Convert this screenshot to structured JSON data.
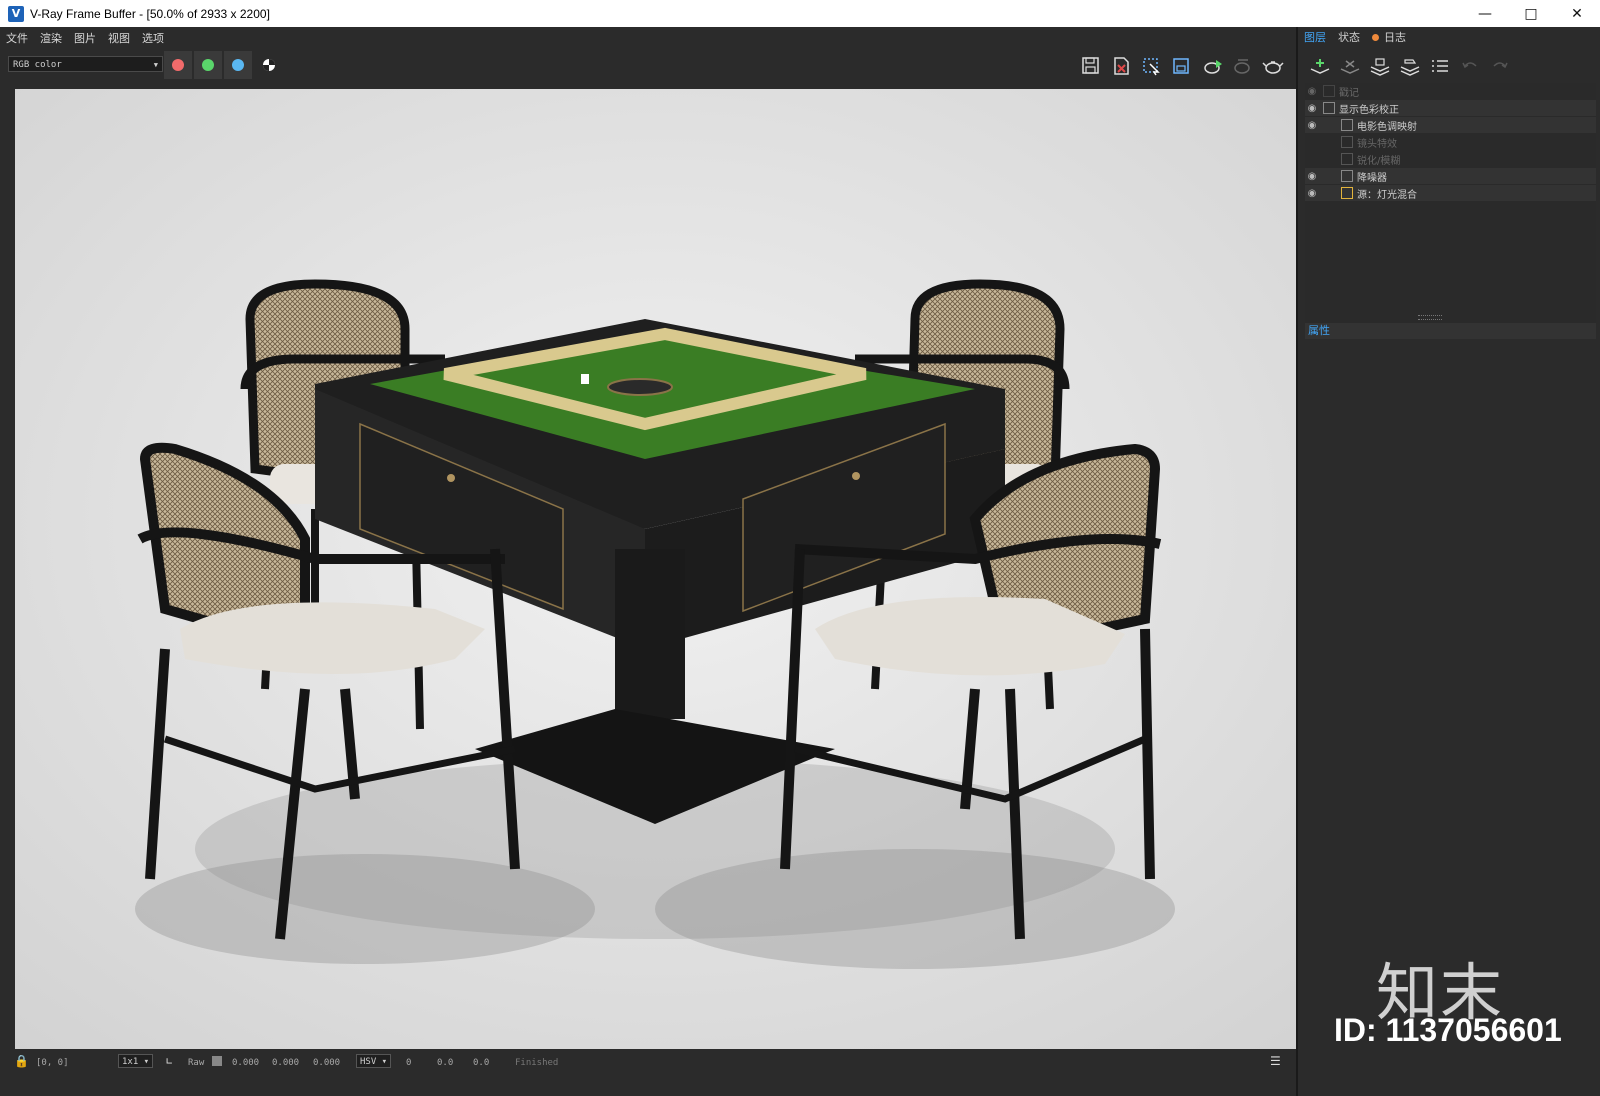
{
  "window": {
    "title": "V-Ray Frame Buffer - [50.0% of 2933 x 2200]",
    "app_icon": "vray-icon",
    "controls": [
      "minimize-icon",
      "maximize-icon",
      "close-icon"
    ]
  },
  "menu": [
    "文件",
    "渲染",
    "图片",
    "视图",
    "选项"
  ],
  "toolbar": {
    "channel": "RGB color",
    "channel_buttons": [
      {
        "name": "red-channel",
        "color": "#f26b6b"
      },
      {
        "name": "green-channel",
        "color": "#5ad66b"
      },
      {
        "name": "blue-channel",
        "color": "#5ab8f2"
      }
    ],
    "right_icons": [
      "save-image-icon",
      "clear-image-icon",
      "region-render-icon",
      "track-mouse-icon",
      "interactive-render-icon",
      "render-last-icon",
      "teapot-render-icon"
    ]
  },
  "status": {
    "coords": "[0, 0]",
    "zoom": "1x1",
    "raw_label": "Raw",
    "raw_values": [
      "0.000",
      "0.000",
      "0.000"
    ],
    "color_mode": "HSV",
    "hsv_values": [
      "0",
      "0.0",
      "0.0"
    ],
    "state": "Finished"
  },
  "sidebar": {
    "tabs": [
      {
        "label": "图层",
        "active": true
      },
      {
        "label": "状态",
        "active": false
      },
      {
        "label": "日志",
        "active": false,
        "dot_color": "#f08a3c"
      }
    ],
    "layer_tools": [
      "add-layer-icon",
      "delete-layer-icon",
      "save-layers-icon",
      "load-layers-icon",
      "layer-list-icon",
      "undo-icon",
      "redo-icon"
    ],
    "layers": [
      {
        "label": "戳记",
        "eye": false,
        "enabled": false,
        "indent": 0
      },
      {
        "label": "显示色彩校正",
        "eye": true,
        "enabled": true,
        "indent": 0
      },
      {
        "label": "电影色调映射",
        "eye": true,
        "enabled": true,
        "indent": 1
      },
      {
        "label": "镜头特效",
        "eye": false,
        "enabled": false,
        "indent": 1
      },
      {
        "label": "锐化/模糊",
        "eye": false,
        "enabled": false,
        "indent": 1
      },
      {
        "label": "降噪器",
        "eye": true,
        "enabled": true,
        "indent": 1
      },
      {
        "label": "源：灯光混合",
        "eye": true,
        "enabled": true,
        "indent": 1
      }
    ],
    "properties_label": "属性"
  },
  "watermark": {
    "logo": "知末",
    "id": "ID: 1137056601"
  },
  "colors": {
    "background": "#2b2b2b",
    "accent": "#42a5f5",
    "felt": "#3a7d24"
  }
}
